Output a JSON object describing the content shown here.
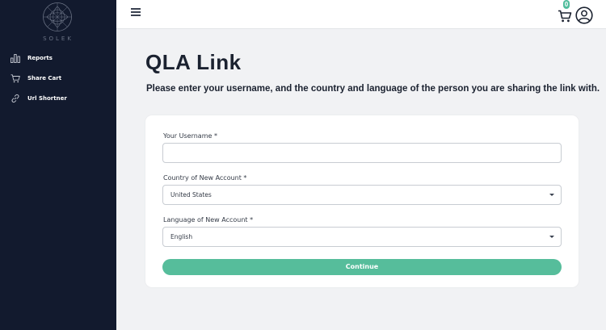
{
  "sidebar": {
    "logo_text": "SOLEK",
    "items": [
      {
        "label": "Reports",
        "icon": "bar-chart-icon"
      },
      {
        "label": "Share Cart",
        "icon": "cart-icon"
      },
      {
        "label": "Url Shortner",
        "icon": "link-icon"
      }
    ]
  },
  "topbar": {
    "cart_count": "0"
  },
  "main": {
    "title": "QLA Link",
    "subtitle": "Please enter your username, and the country and language of the person you are sharing the link with."
  },
  "form": {
    "username_label": "Your Username *",
    "username_value": "",
    "country_label": "Country of New Account *",
    "country_value": "United States",
    "language_label": "Language of New Account *",
    "language_value": "English",
    "continue_label": "Continue"
  },
  "colors": {
    "sidebar_bg": "#121a2e",
    "accent": "#56bd9b",
    "page_bg": "#f1f2f4"
  }
}
